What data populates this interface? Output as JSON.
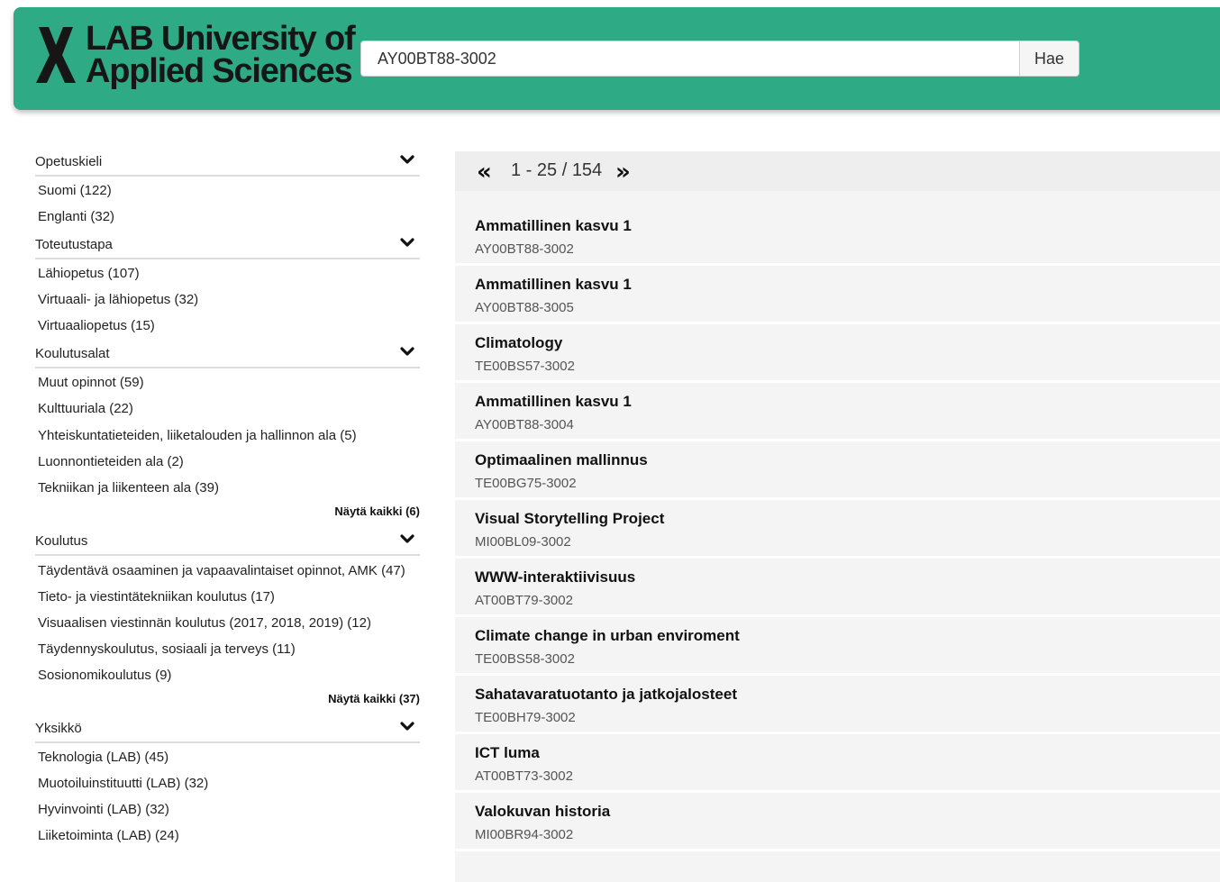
{
  "header": {
    "logo_line1": "LAB University of",
    "logo_line2": "Applied Sciences",
    "search_value": "AY00BT88-3002",
    "search_button": "Hae"
  },
  "facets": [
    {
      "title": "Opetuskieli",
      "items": [
        "Suomi (122)",
        "Englanti (32)"
      ],
      "show_all": ""
    },
    {
      "title": "Toteutustapa",
      "items": [
        "Lähiopetus (107)",
        "Virtuaali- ja lähiopetus (32)",
        "Virtuaaliopetus (15)"
      ],
      "show_all": ""
    },
    {
      "title": "Koulutusalat",
      "items": [
        "Muut opinnot (59)",
        "Kulttuuriala (22)",
        "Yhteiskuntatieteiden, liiketalouden ja hallinnon ala (5)",
        "Luonnontieteiden ala (2)",
        "Tekniikan ja liikenteen ala (39)"
      ],
      "show_all": "Näytä kaikki (6)"
    },
    {
      "title": "Koulutus",
      "items": [
        "Täydentävä osaaminen ja vapaavalintaiset opinnot, AMK (47)",
        "Tieto- ja viestintätekniikan koulutus (17)",
        "Visuaalisen viestinnän koulutus (2017, 2018, 2019) (12)",
        "Täydennyskoulutus, sosiaali ja terveys (11)",
        "Sosionomikoulutus (9)"
      ],
      "show_all": "Näytä kaikki (37)"
    },
    {
      "title": "Yksikkö",
      "items": [
        "Teknologia (LAB) (45)",
        "Muotoiluinstituutti (LAB) (32)",
        "Hyvinvointi (LAB) (32)",
        "Liiketoiminta (LAB) (24)"
      ],
      "show_all": ""
    }
  ],
  "pager": {
    "prev": "«",
    "range": "1 - 25 / 154",
    "next": "»"
  },
  "results": [
    {
      "title": "Ammatillinen kasvu 1",
      "code": "AY00BT88-3002"
    },
    {
      "title": "Ammatillinen kasvu 1",
      "code": "AY00BT88-3005"
    },
    {
      "title": "Climatology",
      "code": "TE00BS57-3002"
    },
    {
      "title": "Ammatillinen kasvu 1",
      "code": "AY00BT88-3004"
    },
    {
      "title": "Optimaalinen mallinnus",
      "code": "TE00BG75-3002"
    },
    {
      "title": "Visual Storytelling Project",
      "code": "MI00BL09-3002"
    },
    {
      "title": "WWW-interaktiivisuus",
      "code": "AT00BT79-3002"
    },
    {
      "title": "Climate change in urban enviroment",
      "code": "TE00BS58-3002"
    },
    {
      "title": "Sahatavaratuotanto ja jatkojalosteet",
      "code": "TE00BH79-3002"
    },
    {
      "title": "ICT luma",
      "code": "AT00BT73-3002"
    },
    {
      "title": "Valokuvan historia",
      "code": "MI00BR94-3002"
    }
  ],
  "colors": {
    "header_bg": "#2eaa85",
    "results_bg": "#f4f4f4"
  }
}
